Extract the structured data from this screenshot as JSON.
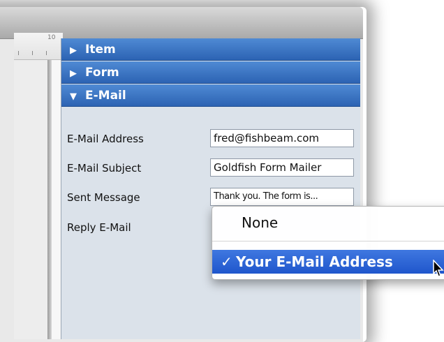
{
  "ruler": {
    "number": "10"
  },
  "inspector": {
    "sections": [
      {
        "label": "Item",
        "expanded": false,
        "triangle": "▶"
      },
      {
        "label": "Form",
        "expanded": false,
        "triangle": "▶"
      },
      {
        "label": "E-Mail",
        "expanded": true,
        "triangle": "▼"
      }
    ],
    "email": {
      "address_label": "E-Mail Address",
      "address_value": "fred@fishbeam.com",
      "subject_label": "E-Mail Subject",
      "subject_value": "Goldfish Form Mailer",
      "sent_message_label": "Sent Message",
      "sent_message_value": "Thank you. The form is...",
      "reply_label": "Reply E-Mail"
    }
  },
  "popup_menu": {
    "items": [
      {
        "label": "None",
        "checked": false
      },
      {
        "label": "Your E-Mail Address",
        "checked": true,
        "check_mark": "✓"
      }
    ]
  },
  "colors": {
    "section_header": "#2c63b3",
    "panel_bg": "#dbe2ea",
    "menu_highlight": "#1f56cc"
  }
}
